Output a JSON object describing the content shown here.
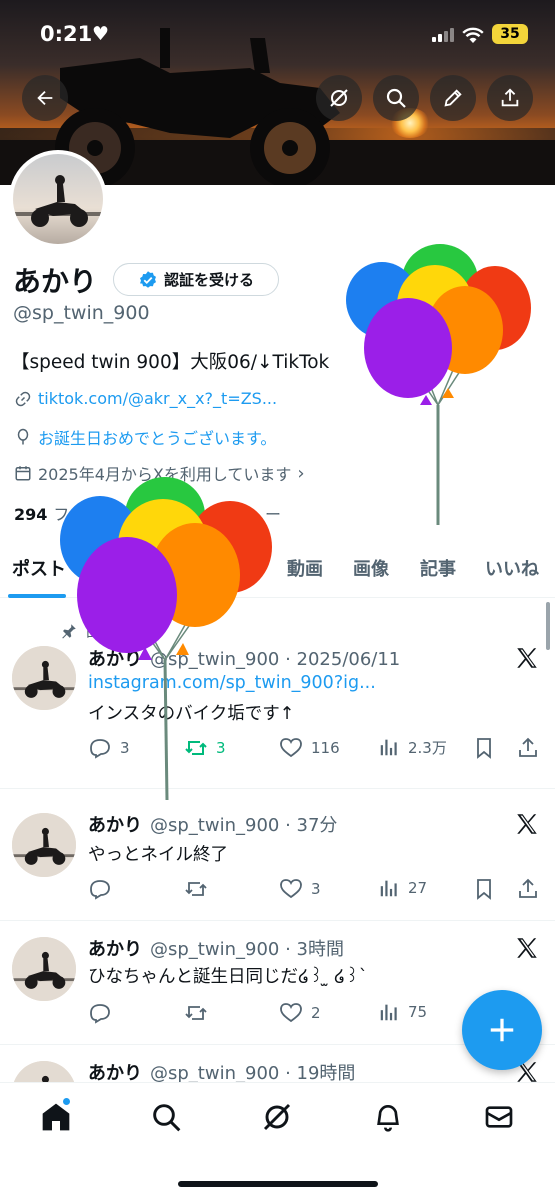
{
  "status_bar": {
    "time": "0:21",
    "battery": "35"
  },
  "banner": {
    "photo": "motorcycle-sunset-silhouette"
  },
  "profile": {
    "name": "あかり",
    "verify_label": "認証を受ける",
    "handle": "@sp_twin_900",
    "bio": "【speed twin 900】大阪06/↓TikTok",
    "link": "tiktok.com/@akr_x_x?_t=ZS...",
    "birthday": "お誕生日おめでとうございます。",
    "joined": "2025年4月からXを利用しています",
    "following_count": "294",
    "following_label": "フ",
    "followers_tail": "ー"
  },
  "tabs": [
    {
      "label": "ポスト"
    },
    {
      "label": "動画"
    },
    {
      "label": "画像"
    },
    {
      "label": "記事"
    },
    {
      "label": "いいね"
    }
  ],
  "pinned": {
    "label": "固"
  },
  "posts": [
    {
      "name": "あかり",
      "handle_time": "@sp_twin_900 · 2025/06/11",
      "link": "instagram.com/sp_twin_900?ig...",
      "text": "インスタのバイク垢です↑",
      "replies": "3",
      "reposts": "3",
      "likes": "116",
      "views": "2.3万"
    },
    {
      "name": "あかり",
      "handle_time": "@sp_twin_900 · 37分",
      "text": "やっとネイル終了",
      "replies": "",
      "reposts": "",
      "likes": "3",
      "views": "27"
    },
    {
      "name": "あかり",
      "handle_time": "@sp_twin_900 · 3時間",
      "text": "ひなちゃんと誕生日同じだ໒꒱ ̫ ໒꒱`",
      "replies": "",
      "reposts": "",
      "likes": "2",
      "views": "75"
    },
    {
      "name": "あかり",
      "handle_time": "@sp_twin_900 · 19時間"
    }
  ],
  "colors": {
    "accent": "#1d9bf0",
    "repost_active": "#00ba7c",
    "text_secondary": "#536471"
  }
}
